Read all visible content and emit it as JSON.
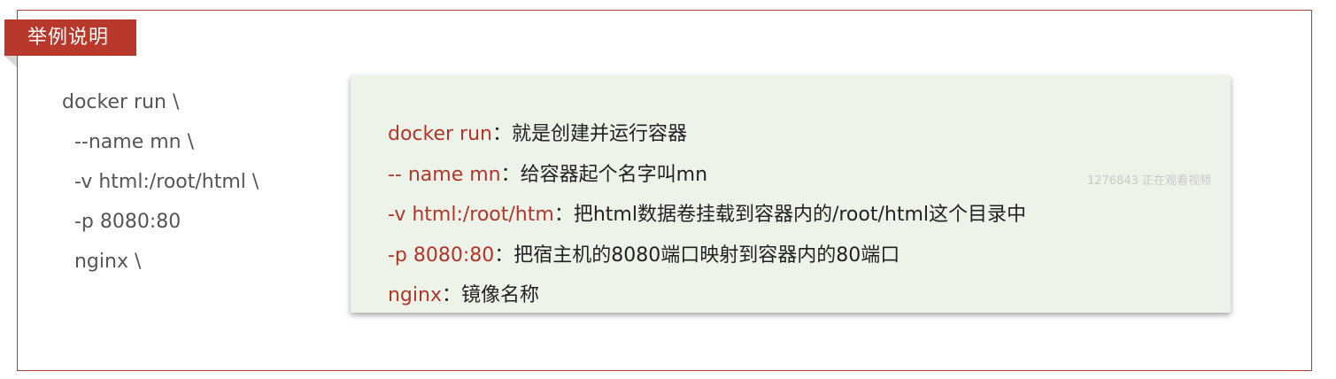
{
  "tag": {
    "label": "举例说明"
  },
  "commands": [
    "docker run \\",
    "  --name mn \\",
    "  -v html:/root/html \\",
    "  -p 8080:80",
    "  nginx \\"
  ],
  "descriptions": [
    {
      "key": "docker run",
      "sep": "：",
      "text": "就是创建并运行容器"
    },
    {
      "key": "-- name mn",
      "sep": "：",
      "text": "给容器起个名字叫mn"
    },
    {
      "key": "-v html:/root/htm",
      "sep": "：",
      "text": "把html数据卷挂载到容器内的/root/html这个目录中"
    },
    {
      "key": "-p 8080:80",
      "sep": "：",
      "text": "把宿主机的8080端口映射到容器内的80端口"
    },
    {
      "key": "nginx",
      "sep": "：",
      "text": "镜像名称"
    }
  ],
  "watermark": "1276843 正在观看视频",
  "colors": {
    "accent": "#b8392b",
    "key_text": "#b0362a",
    "panel_bg": "#eef3ea",
    "border": "#a9413a"
  }
}
